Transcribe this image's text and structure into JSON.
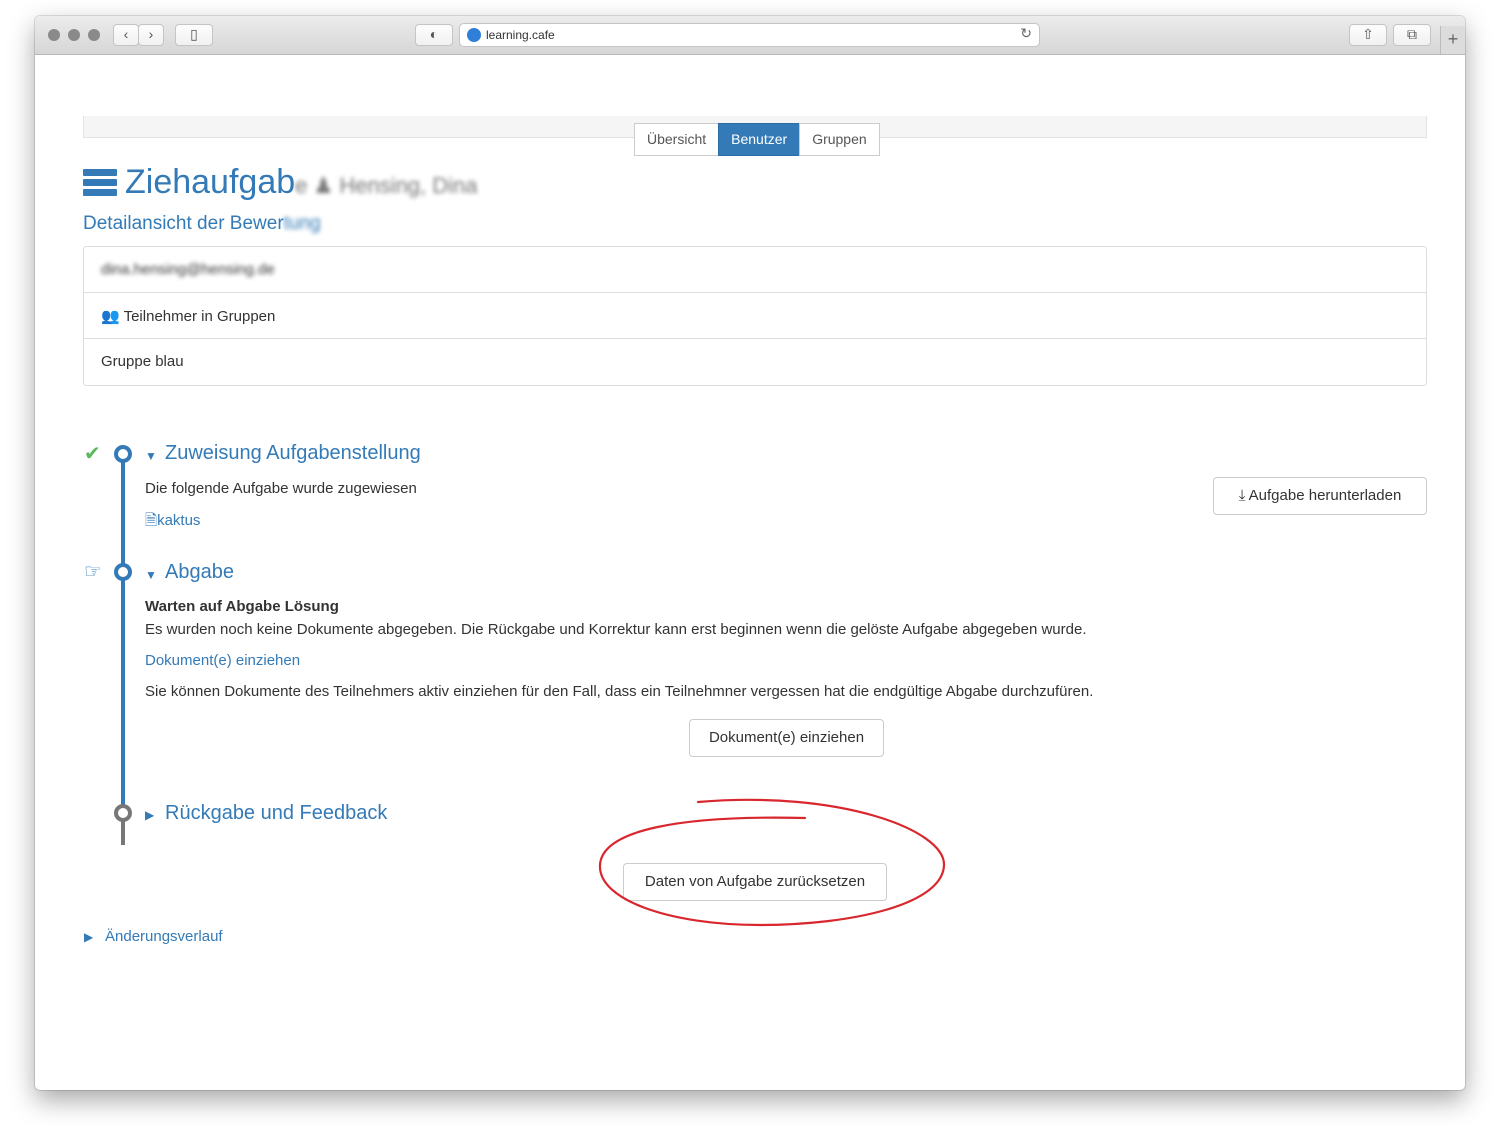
{
  "browser": {
    "url": "learning.cafe",
    "back_glyph": "‹",
    "forward_glyph": "›",
    "sidebar_glyph": "▯",
    "shield_glyph": "◐",
    "reload_glyph": "↻",
    "share_glyph": "⇧",
    "tabs_glyph": "⧉",
    "new_tab_glyph": "+"
  },
  "tabs": [
    "Übersicht",
    "Benutzer",
    "Gruppen"
  ],
  "active_tab": "Benutzer",
  "page": {
    "title": "Ziehaufgab",
    "title_blurred": "e ♟ Hensing, Dina",
    "subtitle": "Detailansicht der Bewer",
    "subtitle_blurred": "tung"
  },
  "info_panel": {
    "email_blurred": "dina.hensing@hensing.de",
    "group_icon": "👥",
    "group_heading": "Teilnehmer in Gruppen",
    "group_name": "Gruppe blau"
  },
  "stages": {
    "assignment": {
      "status_icon": "✔",
      "caret": "▼",
      "title": "Zuweisung Aufgabenstellung",
      "text": "Die folgende Aufgabe wurde zugewiesen",
      "file_icon": "🗎",
      "file_link": "kaktus",
      "download_icon": "⤓",
      "download_button": "Aufgabe herunterladen"
    },
    "submission": {
      "status_icon": "☞",
      "caret": "▼",
      "title": "Abgabe",
      "heading": "Warten auf Abgabe Lösung",
      "text": "Es wurden noch keine Dokumente abgegeben. Die Rückgabe und Korrektur kann erst beginnen wenn die gelöste Aufgabe abgegeben wurde.",
      "link": "Dokument(e) einziehen",
      "hint": "Sie können Dokumente des Teilnehmers aktiv einziehen für den Fall, dass ein Teilnehmner vergessen hat die endgültige Abgabe durchzufüren.",
      "button": "Dokument(e) einziehen"
    },
    "feedback": {
      "caret": "▶",
      "title": "Rückgabe und Feedback"
    }
  },
  "reset_button": "Daten von Aufgabe zurücksetzen",
  "history": {
    "caret": "▶",
    "label": "Änderungsverlauf"
  },
  "colors": {
    "primary": "#337ab7",
    "success": "#5cb85c",
    "annotation": "#d9272e"
  }
}
